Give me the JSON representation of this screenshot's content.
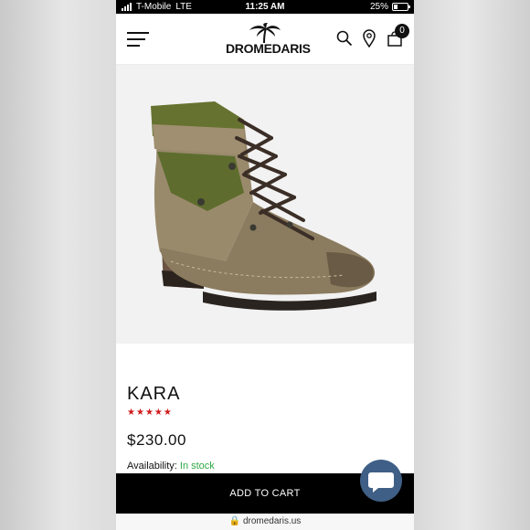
{
  "status_bar": {
    "carrier": "T-Mobile",
    "network": "LTE",
    "time": "11:25 AM",
    "battery": "25%"
  },
  "header": {
    "logo_text": "DROMEDARIS",
    "cart_count": "0",
    "icons": [
      "menu-icon",
      "search-icon",
      "location-pin-icon",
      "cart-icon"
    ]
  },
  "product": {
    "image_icon": "boot-image",
    "name": "KARA",
    "rating": 5,
    "price": "$230.00",
    "availability_label": "Availability:",
    "availability_value": "In stock"
  },
  "actions": {
    "add_to_cart": "ADD TO CART",
    "chat_icon": "chat-bubble-icon"
  },
  "browser": {
    "url": "dromedaris.us"
  },
  "colors": {
    "stars": "#d11a1a",
    "in_stock": "#2eaa45",
    "add_to_cart_bg": "#000000",
    "chat_bg": "#3f5f86"
  }
}
